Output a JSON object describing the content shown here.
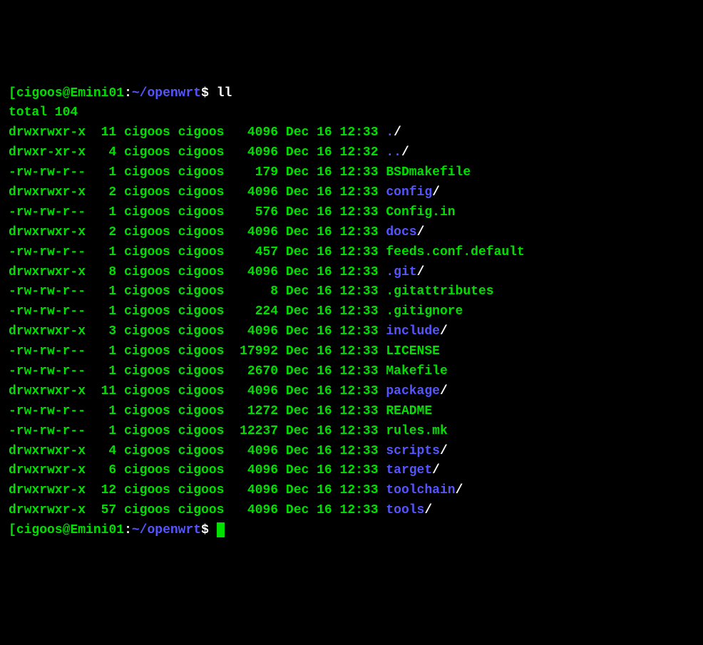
{
  "prompt": {
    "open_bracket": "[",
    "user": "cigoos",
    "at": "@",
    "host": "Emini01",
    "colon": ":",
    "path": "~/openwrt",
    "dollar": "$",
    "command": "ll"
  },
  "total_line": "total 104",
  "rows": [
    {
      "perm": "drwxrwxr-x",
      "links": "11",
      "owner": "cigoos",
      "group": "cigoos",
      "size": "4096",
      "date": "Dec 16 12:33",
      "name": ".",
      "type": "dir"
    },
    {
      "perm": "drwxr-xr-x",
      "links": "4",
      "owner": "cigoos",
      "group": "cigoos",
      "size": "4096",
      "date": "Dec 16 12:32",
      "name": "..",
      "type": "dir"
    },
    {
      "perm": "-rw-rw-r--",
      "links": "1",
      "owner": "cigoos",
      "group": "cigoos",
      "size": "179",
      "date": "Dec 16 12:33",
      "name": "BSDmakefile",
      "type": "file"
    },
    {
      "perm": "drwxrwxr-x",
      "links": "2",
      "owner": "cigoos",
      "group": "cigoos",
      "size": "4096",
      "date": "Dec 16 12:33",
      "name": "config",
      "type": "dir"
    },
    {
      "perm": "-rw-rw-r--",
      "links": "1",
      "owner": "cigoos",
      "group": "cigoos",
      "size": "576",
      "date": "Dec 16 12:33",
      "name": "Config.in",
      "type": "file"
    },
    {
      "perm": "drwxrwxr-x",
      "links": "2",
      "owner": "cigoos",
      "group": "cigoos",
      "size": "4096",
      "date": "Dec 16 12:33",
      "name": "docs",
      "type": "dir"
    },
    {
      "perm": "-rw-rw-r--",
      "links": "1",
      "owner": "cigoos",
      "group": "cigoos",
      "size": "457",
      "date": "Dec 16 12:33",
      "name": "feeds.conf.default",
      "type": "file"
    },
    {
      "perm": "drwxrwxr-x",
      "links": "8",
      "owner": "cigoos",
      "group": "cigoos",
      "size": "4096",
      "date": "Dec 16 12:33",
      "name": ".git",
      "type": "dir"
    },
    {
      "perm": "-rw-rw-r--",
      "links": "1",
      "owner": "cigoos",
      "group": "cigoos",
      "size": "8",
      "date": "Dec 16 12:33",
      "name": ".gitattributes",
      "type": "file"
    },
    {
      "perm": "-rw-rw-r--",
      "links": "1",
      "owner": "cigoos",
      "group": "cigoos",
      "size": "224",
      "date": "Dec 16 12:33",
      "name": ".gitignore",
      "type": "file"
    },
    {
      "perm": "drwxrwxr-x",
      "links": "3",
      "owner": "cigoos",
      "group": "cigoos",
      "size": "4096",
      "date": "Dec 16 12:33",
      "name": "include",
      "type": "dir"
    },
    {
      "perm": "-rw-rw-r--",
      "links": "1",
      "owner": "cigoos",
      "group": "cigoos",
      "size": "17992",
      "date": "Dec 16 12:33",
      "name": "LICENSE",
      "type": "file"
    },
    {
      "perm": "-rw-rw-r--",
      "links": "1",
      "owner": "cigoos",
      "group": "cigoos",
      "size": "2670",
      "date": "Dec 16 12:33",
      "name": "Makefile",
      "type": "file"
    },
    {
      "perm": "drwxrwxr-x",
      "links": "11",
      "owner": "cigoos",
      "group": "cigoos",
      "size": "4096",
      "date": "Dec 16 12:33",
      "name": "package",
      "type": "dir"
    },
    {
      "perm": "-rw-rw-r--",
      "links": "1",
      "owner": "cigoos",
      "group": "cigoos",
      "size": "1272",
      "date": "Dec 16 12:33",
      "name": "README",
      "type": "file"
    },
    {
      "perm": "-rw-rw-r--",
      "links": "1",
      "owner": "cigoos",
      "group": "cigoos",
      "size": "12237",
      "date": "Dec 16 12:33",
      "name": "rules.mk",
      "type": "file"
    },
    {
      "perm": "drwxrwxr-x",
      "links": "4",
      "owner": "cigoos",
      "group": "cigoos",
      "size": "4096",
      "date": "Dec 16 12:33",
      "name": "scripts",
      "type": "dir"
    },
    {
      "perm": "drwxrwxr-x",
      "links": "6",
      "owner": "cigoos",
      "group": "cigoos",
      "size": "4096",
      "date": "Dec 16 12:33",
      "name": "target",
      "type": "dir"
    },
    {
      "perm": "drwxrwxr-x",
      "links": "12",
      "owner": "cigoos",
      "group": "cigoos",
      "size": "4096",
      "date": "Dec 16 12:33",
      "name": "toolchain",
      "type": "dir"
    },
    {
      "perm": "drwxrwxr-x",
      "links": "57",
      "owner": "cigoos",
      "group": "cigoos",
      "size": "4096",
      "date": "Dec 16 12:33",
      "name": "tools",
      "type": "dir"
    }
  ],
  "slash": "/"
}
